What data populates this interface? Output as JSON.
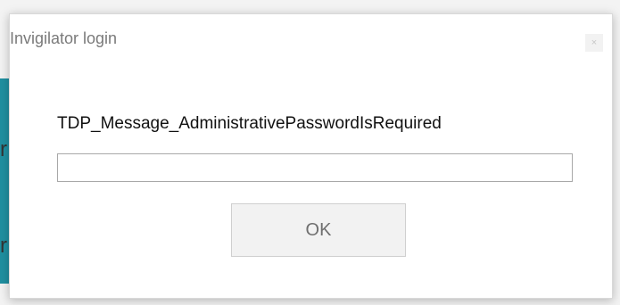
{
  "background": {
    "letter_1": "r",
    "letter_2": "r"
  },
  "dialog": {
    "title": "Invigilator login",
    "close_glyph": "×",
    "message": "TDP_Message_AdministrativePasswordIsRequired",
    "password_value": "",
    "password_placeholder": "",
    "ok_label": "OK"
  },
  "colors": {
    "title_text": "#7a7a7a",
    "message_text": "#111111",
    "button_bg": "#f2f2f2",
    "button_text": "#6f6f6f",
    "input_border": "#a8a8a8",
    "bg_accent_strip": "#1f8fa0"
  },
  "icons": {
    "close": "close-icon"
  }
}
